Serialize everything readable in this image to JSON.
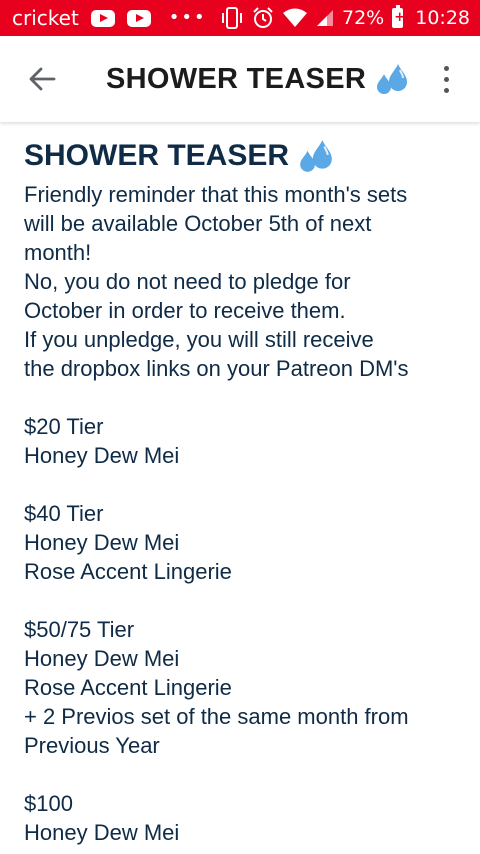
{
  "status": {
    "carrier": "cricket",
    "battery": "72%",
    "time": "10:28",
    "battery_plus": "+"
  },
  "appbar": {
    "title": "SHOWER TEASER"
  },
  "post": {
    "title": "SHOWER TEASER",
    "lines": [
      "Friendly reminder that this month's sets",
      "will be available October 5th of next",
      "month!",
      "No, you do not need to pledge for",
      "October in order to receive them.",
      "If you unpledge, you will still receive",
      "the dropbox links on your Patreon DM's",
      " ",
      "$20 Tier",
      "Honey Dew Mei",
      " ",
      "$40 Tier",
      "Honey Dew Mei",
      "Rose Accent Lingerie",
      " ",
      "$50/75 Tier",
      "Honey Dew Mei",
      "Rose Accent Lingerie",
      "+ 2 Previos set of the same month from",
      "Previous Year",
      " ",
      "$100",
      "Honey Dew Mei"
    ]
  },
  "colors": {
    "status_bar": "#e8001f",
    "text": "#0f2b46",
    "drops": "#5aa8e6"
  },
  "icons": {
    "back": "arrow-left-icon",
    "more": "more-vertical-icon",
    "emoji": "sweat-droplets-icon"
  }
}
